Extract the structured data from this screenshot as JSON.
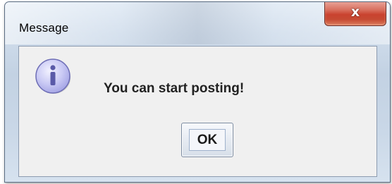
{
  "dialog": {
    "title": "Message",
    "close_label": "x",
    "message": "You can start posting!",
    "ok_label": "OK",
    "icon": "info-icon"
  },
  "colors": {
    "close_button": "#c9432f",
    "content_bg": "#f0f0f0",
    "icon_fill": "#c9c9f4",
    "icon_stroke": "#6d6db5"
  }
}
